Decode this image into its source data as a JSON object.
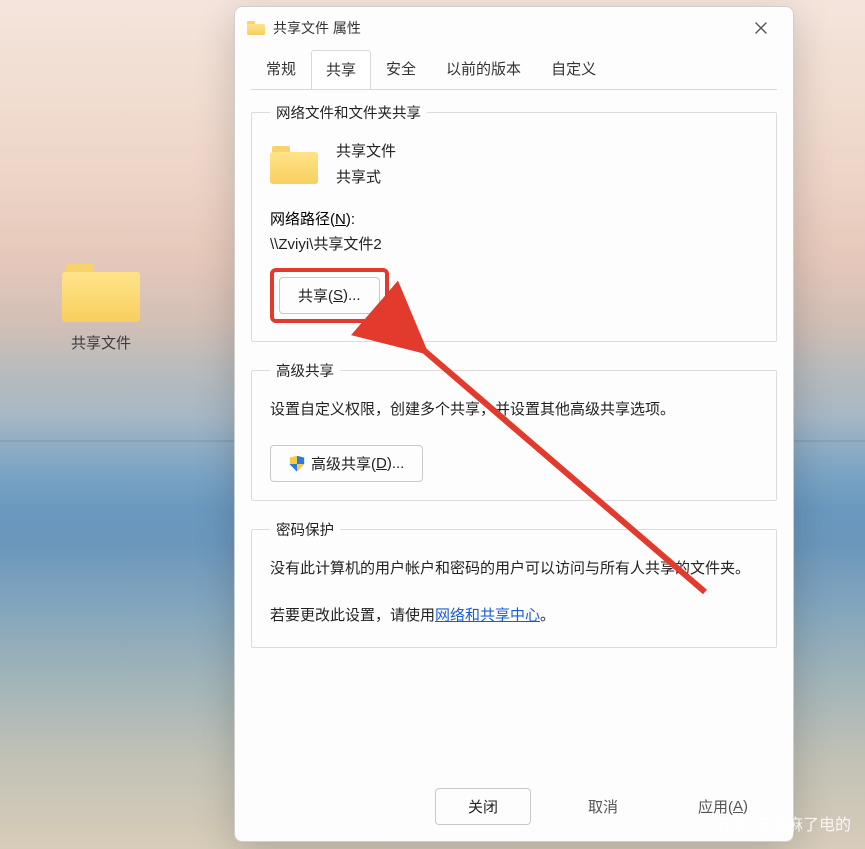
{
  "desktop": {
    "folder_label": "共享文件"
  },
  "dialog": {
    "title": "共享文件 属性",
    "tabs": [
      "常规",
      "共享",
      "安全",
      "以前的版本",
      "自定义"
    ]
  },
  "sections": {
    "network": {
      "legend": "网络文件和文件夹共享",
      "name": "共享文件",
      "status": "共享式",
      "path_label_pre": "网络路径(",
      "path_label_u": "N",
      "path_label_post": "):",
      "path_value": "\\\\Zviyi\\共享文件2",
      "share_btn_pre": "共享(",
      "share_btn_u": "S",
      "share_btn_post": ")..."
    },
    "advanced": {
      "legend": "高级共享",
      "desc": "设置自定义权限，创建多个共享，并设置其他高级共享选项。",
      "btn_pre": "高级共享(",
      "btn_u": "D",
      "btn_post": ")..."
    },
    "password": {
      "legend": "密码保护",
      "desc1": "没有此计算机的用户帐户和密码的用户可以访问与所有人共享的文件夹。",
      "desc2_pre": "若要更改此设置，请使用",
      "link": "网络和共享中心",
      "desc2_post": "。"
    }
  },
  "footer": {
    "close": "关闭",
    "cancel": "取消",
    "apply_pre": "应用(",
    "apply_u": "A",
    "apply_post": ")"
  },
  "watermark": "知乎 @手麻了电的",
  "annotation": {
    "highlight": "share-button",
    "arrow_color": "#e23b2e"
  }
}
